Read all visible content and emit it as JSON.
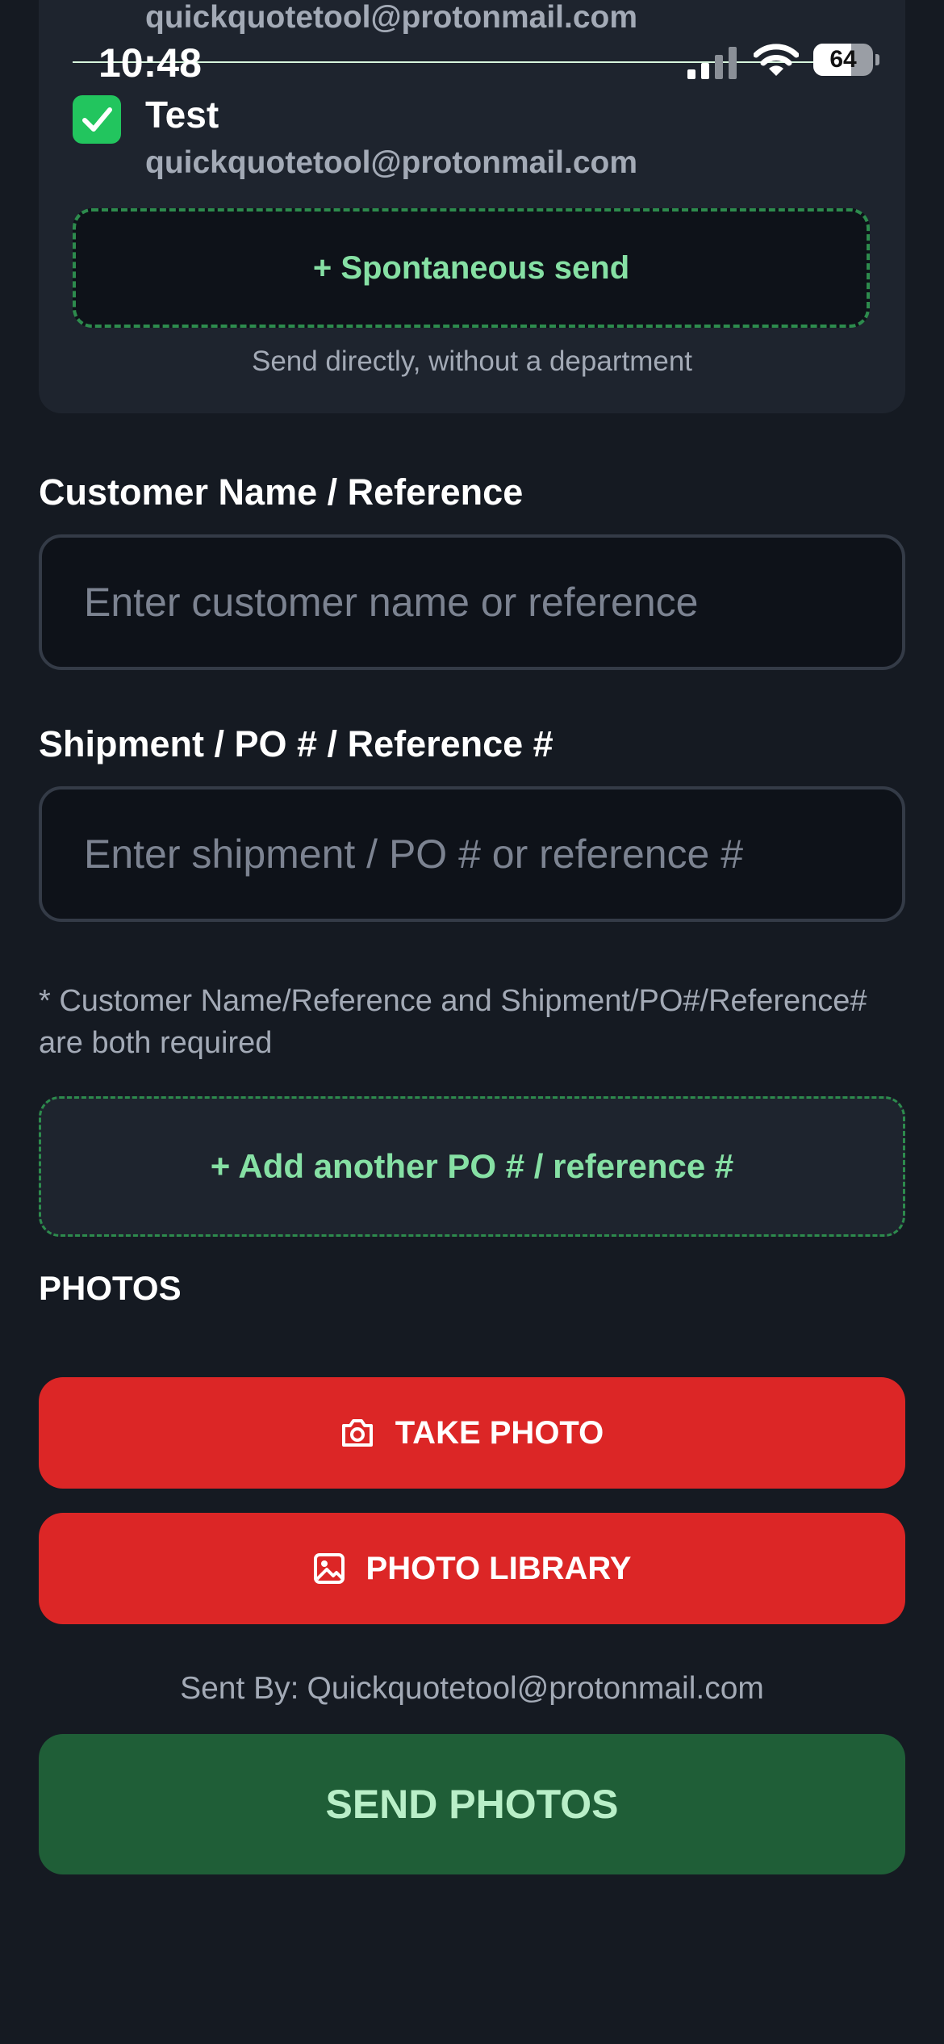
{
  "status_bar": {
    "time": "10:48",
    "battery_level": "64",
    "battery_fraction": 0.64
  },
  "recipients": {
    "previous_email": "quickquotetool@protonmail.com",
    "items": [
      {
        "name": "Test",
        "email": "quickquotetool@protonmail.com",
        "checked": true
      }
    ],
    "spontaneous_label": "+ Spontaneous send",
    "spontaneous_caption": "Send directly, without a department"
  },
  "form": {
    "customer_label": "Customer Name / Reference",
    "customer_placeholder": "Enter customer name or reference",
    "customer_value": "",
    "shipment_label": "Shipment / PO # / Reference #",
    "shipment_placeholder": "Enter shipment / PO # or reference #",
    "shipment_value": "",
    "required_note": "* Customer Name/Reference and Shipment/PO#/Reference# are both required",
    "add_po_label": "+ Add another PO # / reference #"
  },
  "photos": {
    "heading": "PHOTOS",
    "take_photo_label": "TAKE PHOTO",
    "library_label": "PHOTO LIBRARY"
  },
  "footer": {
    "sent_by_label": "Sent By:",
    "sent_by_email": "Quickquotetool@protonmail.com",
    "send_label": "SEND PHOTOS"
  },
  "colors": {
    "background": "#151a22",
    "card": "#1e242e",
    "accent_green": "#22c55e",
    "dashed_green": "#2d8b4d",
    "red_button": "#dc2626",
    "send_button": "#1f5e37"
  },
  "icons": {
    "checkbox": "checkmark-icon",
    "take_photo": "camera-icon",
    "library": "image-icon"
  }
}
